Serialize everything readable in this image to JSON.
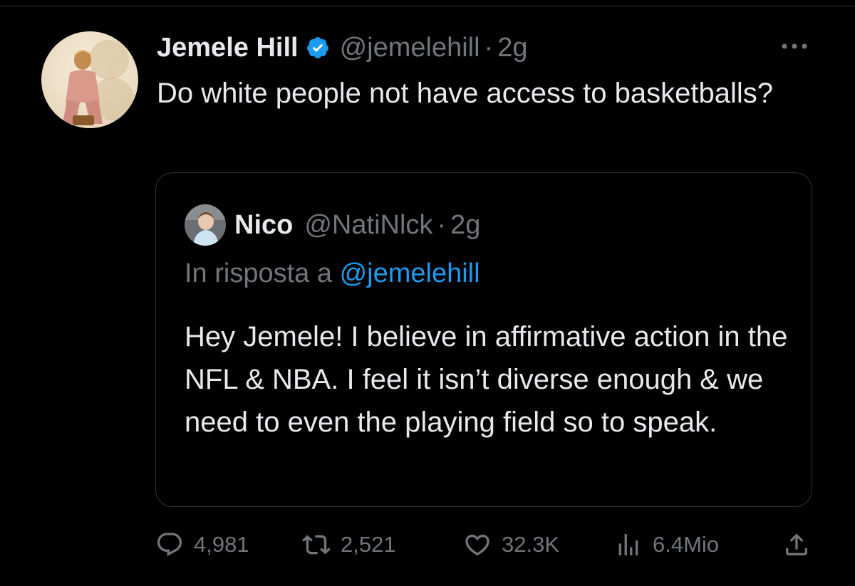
{
  "tweet": {
    "author_name": "Jemele Hill",
    "author_handle": "@jemelehill",
    "time": "2g",
    "text": "Do white people not have access to basketballs?"
  },
  "quoted_tweet": {
    "author_name": "Nico",
    "author_handle": "@NatiNlck",
    "time": "2g",
    "reply_prefix": "In risposta a",
    "reply_to": "@jemelehill",
    "text": "Hey Jemele! I believe in affirmative action in the NFL & NBA. I feel it isn’t diverse enough & we need to even the playing field so to speak."
  },
  "actions": {
    "replies": "4,981",
    "reposts": "2,521",
    "likes": "32.3K",
    "views": "6.4Mio"
  },
  "separator": "·",
  "icons": {
    "verified": "verified-badge-icon",
    "more": "more-options-icon",
    "reply": "reply-icon",
    "repost": "repost-icon",
    "like": "heart-icon",
    "views": "views-chart-icon",
    "share": "share-icon"
  },
  "colors": {
    "background": "#000000",
    "text_primary": "#e7e9ea",
    "text_secondary": "#71767b",
    "link": "#1d9bf0",
    "verified": "#1d9bf0",
    "border": "#2f3336"
  }
}
